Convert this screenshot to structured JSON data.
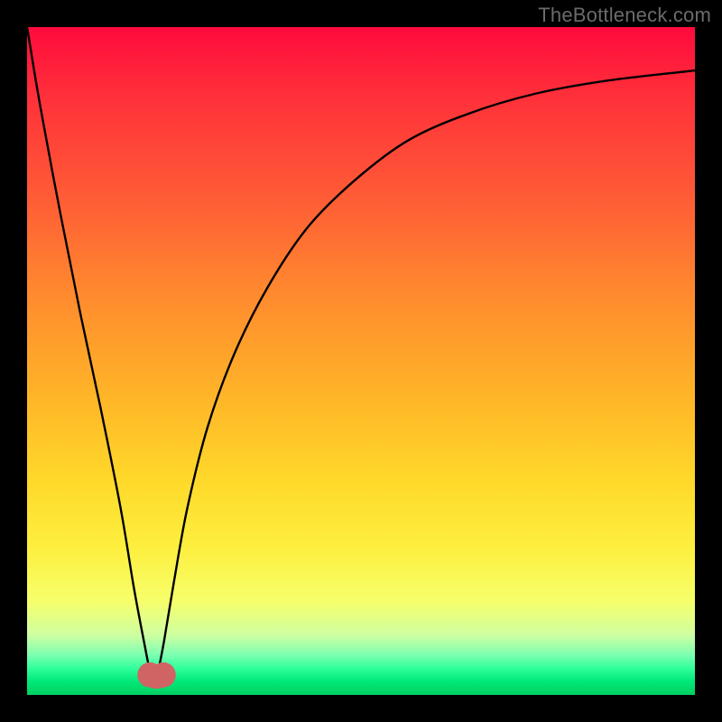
{
  "watermark": "TheBottleneck.com",
  "chart_data": {
    "type": "line",
    "title": "",
    "xlabel": "",
    "ylabel": "",
    "xlim": [
      0,
      100
    ],
    "ylim": [
      0,
      100
    ],
    "note": "Axes are unlabeled in the source image; values below are estimated from pixel positions (0–100 normalized). Curve appears to be an |asymptotic| bottleneck curve with its minimum near x≈19.",
    "series": [
      {
        "name": "bottleneck-curve",
        "x": [
          0,
          2,
          5,
          8,
          11,
          14,
          16,
          17.5,
          18.5,
          19,
          19.5,
          20.5,
          22,
          24,
          27,
          31,
          36,
          42,
          49,
          57,
          66,
          76,
          87,
          100
        ],
        "y": [
          100,
          88,
          72,
          57,
          43,
          28,
          16,
          8,
          3,
          1.5,
          3,
          8,
          17,
          28,
          40,
          51,
          61,
          70,
          77,
          83,
          87,
          90,
          92,
          93.5
        ]
      }
    ],
    "markers": [
      {
        "name": "min-left",
        "x": 18.4,
        "y": 3.0,
        "color": "#d06464",
        "r": 1.2
      },
      {
        "name": "min-right",
        "x": 20.4,
        "y": 3.0,
        "color": "#d06464",
        "r": 1.2
      }
    ],
    "min_highlight": {
      "x_from": 18.0,
      "x_to": 20.8,
      "y": 1.6,
      "color": "#d06464"
    },
    "colors": {
      "curve": "#000000",
      "gradient_top": "#ff0a3c",
      "gradient_mid": "#ffd92a",
      "gradient_bottom": "#00d060"
    }
  }
}
